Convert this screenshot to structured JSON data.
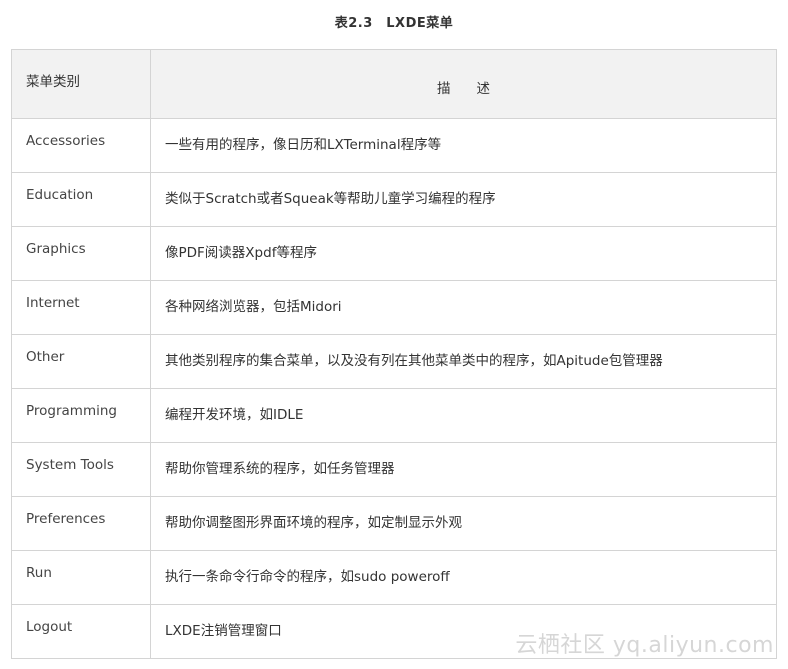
{
  "caption": "表2.3　LXDE菜单",
  "headers": {
    "category": "菜单类别",
    "description": "描述"
  },
  "rows": [
    {
      "category": "Accessories",
      "description": "一些有用的程序，像日历和LXTerminal程序等"
    },
    {
      "category": "Education",
      "description": "类似于Scratch或者Squeak等帮助儿童学习编程的程序"
    },
    {
      "category": "Graphics",
      "description": "像PDF阅读器Xpdf等程序"
    },
    {
      "category": "Internet",
      "description": "各种网络浏览器，包括Midori"
    },
    {
      "category": "Other",
      "description": "其他类别程序的集合菜单，以及没有列在其他菜单类中的程序，如Apitude包管理器"
    },
    {
      "category": "Programming",
      "description": "编程开发环境，如IDLE"
    },
    {
      "category": "System Tools",
      "description": "帮助你管理系统的程序，如任务管理器"
    },
    {
      "category": "Preferences",
      "description": "帮助你调整图形界面环境的程序，如定制显示外观"
    },
    {
      "category": "Run",
      "description": "执行一条命令行命令的程序，如sudo poweroff"
    },
    {
      "category": "Logout",
      "description": "LXDE注销管理窗口"
    }
  ],
  "watermark": "云栖社区 yq.aliyun.com"
}
